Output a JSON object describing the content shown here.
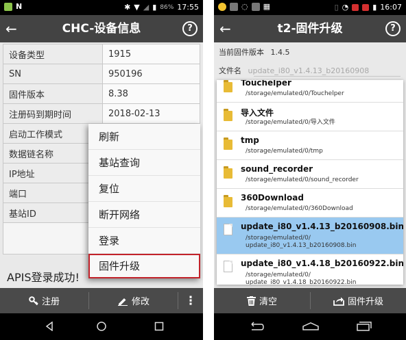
{
  "left_screen": {
    "statusbar": {
      "battery_text": "86%",
      "time": "17:55"
    },
    "title": "CHC-设备信息",
    "help_label": "?",
    "info_rows": [
      {
        "label": "设备类型",
        "value": "1915"
      },
      {
        "label": "SN",
        "value": "950196"
      },
      {
        "label": "固件版本",
        "value": "8.38"
      },
      {
        "label": "注册码到期时间",
        "value": "2018-02-13"
      },
      {
        "label": "启动工作模式",
        "value": ""
      },
      {
        "label": "数据链名称",
        "value": ""
      },
      {
        "label": "IP地址",
        "value": ""
      },
      {
        "label": "端口",
        "value": ""
      },
      {
        "label": "基站ID",
        "value": ""
      }
    ],
    "status_message": "APIS登录成功!",
    "popup_menu": [
      "刷新",
      "基站查询",
      "复位",
      "断开网络",
      "登录",
      "固件升级"
    ],
    "popup_highlighted_index": 5,
    "bottom_bar": {
      "register_label": "注册",
      "edit_label": "修改",
      "more_label": "⋮"
    },
    "colors": {
      "titlebar": "#434343",
      "bottombar": "#4a4a4a",
      "highlight_border": "#c2222a"
    }
  },
  "right_screen": {
    "statusbar": {
      "time": "16:07"
    },
    "title": "t2-固件升级",
    "help_label": "?",
    "current_version_label": "当前固件版本",
    "current_version_value": "1.4.5",
    "filename_label": "文件名",
    "filename_value": "update_i80_v1.4.13_b20160908",
    "files": [
      {
        "name": "Touchelper",
        "path1": "/storage/emulated/0/Touchelper",
        "path2": "",
        "type": "folder"
      },
      {
        "name": "导入文件",
        "path1": "/storage/emulated/0/导入文件",
        "path2": "",
        "type": "folder"
      },
      {
        "name": "tmp",
        "path1": "/storage/emulated/0/tmp",
        "path2": "",
        "type": "folder"
      },
      {
        "name": "sound_recorder",
        "path1": "/storage/emulated/0/sound_recorder",
        "path2": "",
        "type": "folder"
      },
      {
        "name": "360Download",
        "path1": "/storage/emulated/0/360Download",
        "path2": "",
        "type": "folder"
      },
      {
        "name": "update_i80_v1.4.13_b20160908.bin",
        "path1": "/storage/emulated/0/",
        "path2": "update_i80_v1.4.13_b20160908.bin",
        "type": "file",
        "selected": true
      },
      {
        "name": "update_i80_v1.4.18_b20160922.bin",
        "path1": "/storage/emulated/0/",
        "path2": "update_i80_v1.4.18_b20160922.bin",
        "type": "file"
      }
    ],
    "bottom_bar": {
      "clear_label": "清空",
      "upgrade_label": "固件升级"
    },
    "colors": {
      "selected_row": "#99c9f0",
      "folder": "#e8bb36"
    }
  }
}
